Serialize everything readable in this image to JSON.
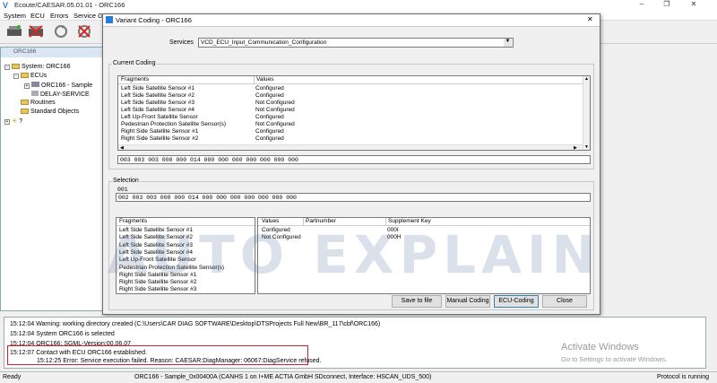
{
  "app": {
    "title": "Ecoute/CAESAR.05.01.01 - ORC166",
    "logo": "V",
    "menu": [
      "System",
      "ECU",
      "Errors",
      "Service Gro"
    ]
  },
  "mdi": {
    "title": "ORC166",
    "tree": {
      "system": "System: ORC166",
      "ecus": "ECUs",
      "ecu_item": "ORC166 - Sample",
      "delay": "DELAY-SERVICE",
      "routines": "Routines",
      "standard": "Standard Objects",
      "help": "?"
    }
  },
  "dialog": {
    "title": "Variant Coding - ORC166",
    "services_label": "Services",
    "services_value": "VCD_ECU_Input_Communication_Configuration",
    "current_coding_label": "Current Coding",
    "current_table": {
      "headers": [
        "Fragments",
        "Values"
      ],
      "rows": [
        [
          "Left Side Satellite Sensor #1",
          "Configured"
        ],
        [
          "Left Side Satellite Sensor #2",
          "Configured"
        ],
        [
          "Left Side Satellite Sensor #3",
          "Not Configured"
        ],
        [
          "Left Side Satellite Sensor #4",
          "Not Configured"
        ],
        [
          "Left Up-Front Satellite Sensor",
          "Configured"
        ],
        [
          "Pedestrian Protection Satellite Sensor(s)",
          "Not Configured"
        ],
        [
          "Right Side Satellite Sensor #1",
          "Configured"
        ],
        [
          "Right Side Satellite Sensor #2",
          "Configured"
        ]
      ]
    },
    "current_hex": "003 003 003 000 000 014 000 000 000 000 000 000 000",
    "selection_label": "Selection",
    "selection_index": "001",
    "selection_hex": "002 003 003 000 000 014 000 000 000 000 000 000 000",
    "fragments_header": "Fragments",
    "fragments": [
      "Left Side Satellite Sensor #1",
      "Left Side Satellite Sensor #2",
      "Left Side Satellite Sensor #3",
      "Left Side Satellite Sensor #4",
      "Left Up-Front Satellite Sensor",
      "Pedestrian Protection Satellite Sensor(s)",
      "Right Side Satellite Sensor #1",
      "Right Side Satellite Sensor #2",
      "Right Side Satellite Sensor #3"
    ],
    "values_table": {
      "headers": [
        "Values",
        "Partnumber",
        "Supplement Key"
      ],
      "rows": [
        [
          "Configured",
          "",
          "000I"
        ],
        [
          "Not Configured",
          "",
          "000H"
        ]
      ]
    },
    "buttons": {
      "save": "Save to file",
      "manual": "Manual Coding",
      "ecu": "ECU-Coding",
      "close": "Close"
    }
  },
  "log": [
    "15:12:04 Warning: working directory created (C:\\Users\\CAR DIAG SOFTWARE\\Desktop\\DTSProjects Full New\\BR_117\\cbf\\ORC166)",
    "15:12:04 System ORC166 is selected",
    "15:12:04 ORC166: SGML-Version:00.06.07",
    "15:12:07 Contact with ECU ORC166 established.",
    "15:12:25 Error: Service execution failed. Reason:  CAESAR:DiagManager: 06067:DiagService refused."
  ],
  "status": {
    "left": "Ready",
    "center": "ORC166 - Sample_0x00400A (CANHS 1 on I+ME ACTIA GmbH SDconnect, Interface: HSCAN_UDS_500)",
    "right": "Protocol is running"
  },
  "overlay": {
    "watermark": "AUTO EXPLAIN",
    "activate_title": "Activate Windows",
    "activate_sub": "Go to Settings to activate Windows."
  },
  "colors": {
    "accent": "#2b7bd6",
    "error_box": "#cc2233"
  }
}
